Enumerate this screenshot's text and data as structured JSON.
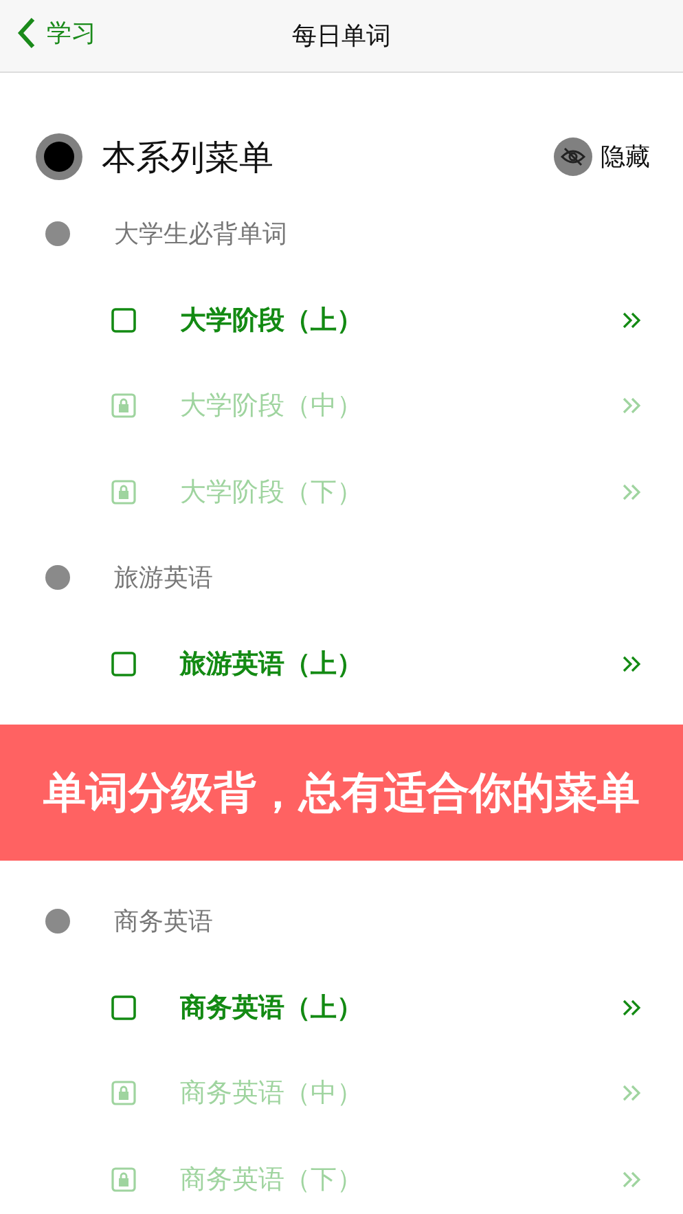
{
  "nav": {
    "back_label": "学习",
    "title": "每日单词"
  },
  "series": {
    "title": "本系列菜单",
    "hide_label": "隐藏"
  },
  "groups": [
    {
      "name": "大学生必背单词",
      "items": [
        {
          "label": "大学阶段（上）",
          "locked": false
        },
        {
          "label": "大学阶段（中）",
          "locked": true
        },
        {
          "label": "大学阶段（下）",
          "locked": true
        }
      ]
    },
    {
      "name": "旅游英语",
      "items": [
        {
          "label": "旅游英语（上）",
          "locked": false
        }
      ]
    },
    {
      "name": "商务英语",
      "items": [
        {
          "label": "商务英语（上）",
          "locked": false
        },
        {
          "label": "商务英语（中）",
          "locked": true
        },
        {
          "label": "商务英语（下）",
          "locked": true
        }
      ]
    }
  ],
  "banner": "单词分级背，总有适合你的菜单"
}
